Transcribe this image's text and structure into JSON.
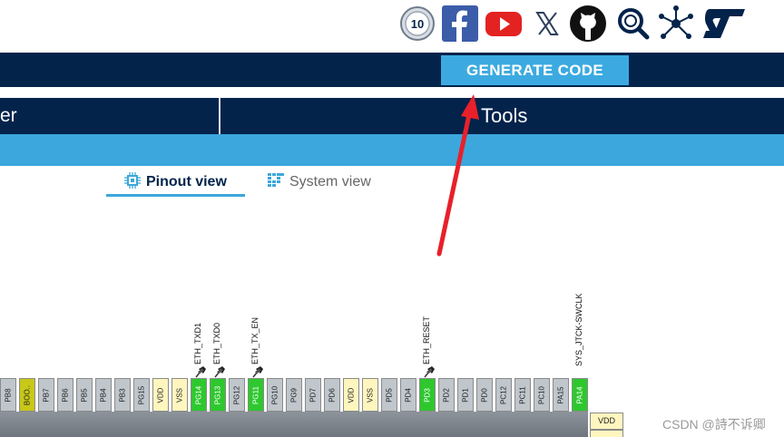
{
  "social_icons": [
    "anniversary-badge-icon",
    "facebook-icon",
    "youtube-icon",
    "x-icon",
    "github-icon",
    "community-search-icon",
    "network-icon",
    "st-logo-icon"
  ],
  "social_badge_text": "10",
  "toolbar": {
    "generate_label": "GENERATE CODE"
  },
  "nav": {
    "left_partial_label": "er",
    "tools_label": "Tools"
  },
  "tabs": [
    {
      "label": "Pinout view",
      "active": true
    },
    {
      "label": "System view",
      "active": false
    }
  ],
  "colors": {
    "dark_navy": "#03234b",
    "accent_blue": "#3ca7dc",
    "pin_green": "#2ec82e",
    "pin_yellow": "#fff6bf",
    "pin_gray": "#bfc6cc",
    "arrow_red": "#e8202a"
  },
  "pins": [
    {
      "label": "PB8",
      "type": "gray"
    },
    {
      "label": "BOO..",
      "type": "olive"
    },
    {
      "label": "PB7",
      "type": "gray"
    },
    {
      "label": "PB6",
      "type": "gray"
    },
    {
      "label": "PB5",
      "type": "gray"
    },
    {
      "label": "PB4",
      "type": "gray"
    },
    {
      "label": "PB3",
      "type": "gray"
    },
    {
      "label": "PG15",
      "type": "gray"
    },
    {
      "label": "VDD",
      "type": "yellow"
    },
    {
      "label": "VSS",
      "type": "yellow"
    },
    {
      "label": "PG14",
      "type": "green",
      "signal": "ETH_TXD1",
      "pinned": true
    },
    {
      "label": "PG13",
      "type": "green",
      "signal": "ETH_TXD0",
      "pinned": true
    },
    {
      "label": "PG12",
      "type": "gray"
    },
    {
      "label": "PG11",
      "type": "green",
      "signal": "ETH_TX_EN",
      "pinned": true
    },
    {
      "label": "PG10",
      "type": "gray"
    },
    {
      "label": "PG9",
      "type": "gray"
    },
    {
      "label": "PD7",
      "type": "gray"
    },
    {
      "label": "PD6",
      "type": "gray"
    },
    {
      "label": "VDD",
      "type": "yellow"
    },
    {
      "label": "VSS",
      "type": "yellow"
    },
    {
      "label": "PD5",
      "type": "gray"
    },
    {
      "label": "PD4",
      "type": "gray"
    },
    {
      "label": "PD3",
      "type": "green",
      "signal": "ETH_RESET",
      "pinned": true
    },
    {
      "label": "PD2",
      "type": "gray"
    },
    {
      "label": "PD1",
      "type": "gray"
    },
    {
      "label": "PD0",
      "type": "gray"
    },
    {
      "label": "PC12",
      "type": "gray"
    },
    {
      "label": "PC11",
      "type": "gray"
    },
    {
      "label": "PC10",
      "type": "gray"
    },
    {
      "label": "PA15",
      "type": "gray"
    },
    {
      "label": "PA14",
      "type": "green",
      "signal": "SYS_JTCK-SWCLK",
      "pinned": false
    }
  ],
  "right_pin": "VDD",
  "watermark": "CSDN @詩不诉卿"
}
